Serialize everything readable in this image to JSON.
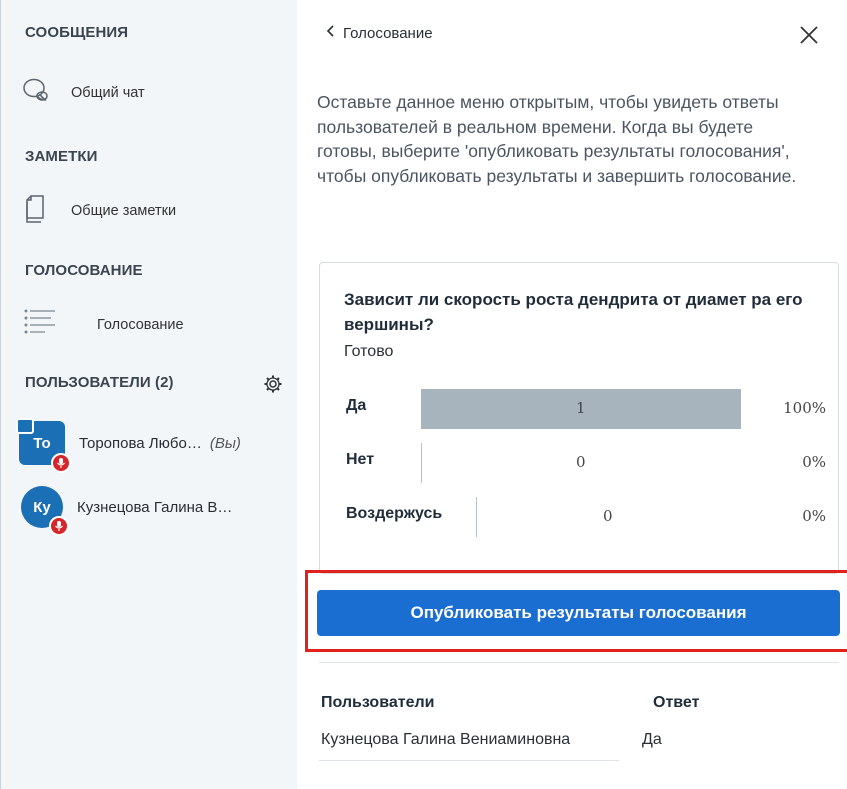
{
  "sidebar": {
    "messages_title": "СООБЩЕНИЯ",
    "public_chat": "Общий чат",
    "notes_title": "ЗАМЕТКИ",
    "shared_notes": "Общие заметки",
    "polling_title": "ГОЛОСОВАНИЕ",
    "polling_item": "Голосование",
    "users_title": "ПОЛЬЗОВАТЕЛИ (2)",
    "users": [
      {
        "initials": "То",
        "name": "Торопова Любо…",
        "suffix": "(Вы)"
      },
      {
        "initials": "Ку",
        "name": "Кузнецова Галина В…",
        "suffix": ""
      }
    ]
  },
  "panel": {
    "back_label": "Голосование",
    "instructions": "Оставьте данное меню открытым, чтобы увидеть ответы пользователей в реальном времени. Когда вы будете готовы, выберите 'опубликовать результаты голосования', чтобы опубликовать результаты и завершить голосование.",
    "question": "Зависит ли скорость роста дендрита от диамет ра его вершины?",
    "status": "Готово",
    "options": [
      {
        "label": "Да",
        "count": "1",
        "percent": "100%"
      },
      {
        "label": "Нет",
        "count": "0",
        "percent": "0%"
      },
      {
        "label": "Воздержусь",
        "count": "0",
        "percent": "0%"
      }
    ],
    "publish_label": "Опубликовать результаты голосования",
    "table": {
      "col_users": "Пользователи",
      "col_answer": "Ответ",
      "rows": [
        {
          "user": "Кузнецова Галина Вениаминовна",
          "answer": "Да"
        }
      ]
    }
  },
  "colors": {
    "accent": "#1a6ed1",
    "highlight": "#e0211c",
    "avatar": "#1b6fb5",
    "bar": "#a7b3bd"
  }
}
